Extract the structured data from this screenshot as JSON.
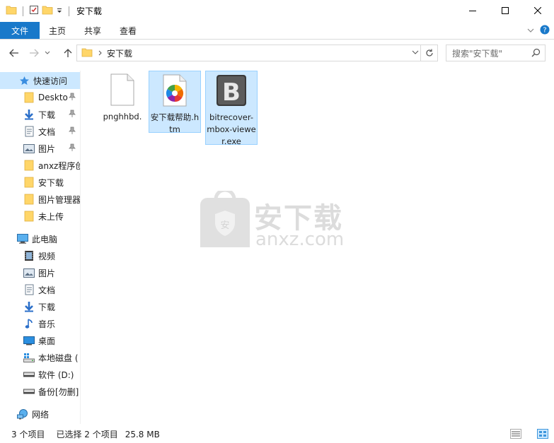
{
  "window": {
    "title": "安下载",
    "controls": [
      "minimize",
      "maximize",
      "close"
    ]
  },
  "ribbon": {
    "tabs": [
      "文件",
      "主页",
      "共享",
      "查看"
    ]
  },
  "address": {
    "crumb": "安下载",
    "search_placeholder": "搜索\"安下载\""
  },
  "sidebar": {
    "quick_access": "快速访问",
    "quick_items": [
      {
        "label": "Deskto",
        "icon": "folder-icon",
        "pinned": true
      },
      {
        "label": "下载",
        "icon": "download-icon",
        "pinned": true
      },
      {
        "label": "文档",
        "icon": "document-icon",
        "pinned": true
      },
      {
        "label": "图片",
        "icon": "picture-icon",
        "pinned": true
      },
      {
        "label": "anxz程序创",
        "icon": "folder-icon",
        "pinned": false
      },
      {
        "label": "安下载",
        "icon": "folder-icon",
        "pinned": false
      },
      {
        "label": "图片管理器",
        "icon": "folder-icon",
        "pinned": false
      },
      {
        "label": "未上传",
        "icon": "folder-icon",
        "pinned": false
      }
    ],
    "this_pc": "此电脑",
    "pc_items": [
      {
        "label": "视频",
        "icon": "video-icon"
      },
      {
        "label": "图片",
        "icon": "picture-icon"
      },
      {
        "label": "文档",
        "icon": "document-icon"
      },
      {
        "label": "下载",
        "icon": "download-icon"
      },
      {
        "label": "音乐",
        "icon": "music-icon"
      },
      {
        "label": "桌面",
        "icon": "desktop-icon"
      },
      {
        "label": "本地磁盘 (",
        "icon": "drive-icon"
      },
      {
        "label": "软件 (D:)",
        "icon": "drive-icon"
      },
      {
        "label": "备份[勿删]",
        "icon": "drive-icon"
      }
    ],
    "network": "网络"
  },
  "files": [
    {
      "name": "pnghhbd.",
      "icon": "blank-file-icon",
      "selected": false
    },
    {
      "name": "安下载帮助.htm",
      "icon": "htm-file-icon",
      "selected": true
    },
    {
      "name": "bitrecover-mbox-viewer.exe",
      "icon": "exe-b-icon",
      "selected": true
    }
  ],
  "watermark": {
    "text_cn": "安下载",
    "text_en": "anxz.com"
  },
  "status": {
    "count": "3 个项目",
    "selection": "已选择 2 个项目",
    "size": "25.8 MB"
  },
  "colors": {
    "accent": "#1979ca",
    "selection_bg": "#cce8ff",
    "selection_border": "#99d1ff",
    "folder": "#ffd669"
  }
}
